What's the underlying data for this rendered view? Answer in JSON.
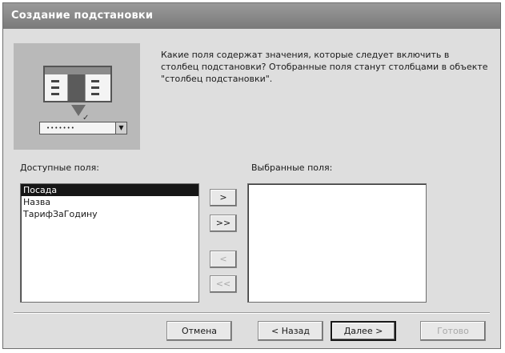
{
  "window": {
    "title": "Создание подстановки"
  },
  "description": "Какие поля содержат значения, которые следует включить в столбец подстановки? Отобранные поля станут столбцами в объекте \"столбец подстановки\".",
  "illustration": {
    "combo_value": "•••••••"
  },
  "available": {
    "label": "Доступные поля:",
    "items": [
      "Посада",
      "Назва",
      "ТарифЗаГодину"
    ],
    "selected_index": 0
  },
  "selected": {
    "label": "Выбранные поля:",
    "items": []
  },
  "move_buttons": {
    "add_one": ">",
    "add_all": ">>",
    "remove_one": "<",
    "remove_all": "<<"
  },
  "footer": {
    "cancel": "Отмена",
    "back": "< Назад",
    "next": "Далее >",
    "finish": "Готово"
  }
}
